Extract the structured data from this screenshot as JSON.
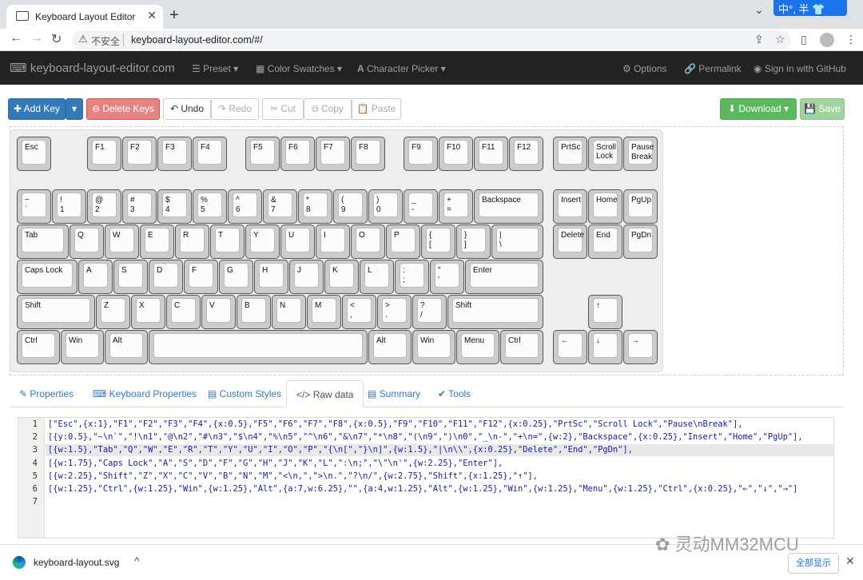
{
  "browser": {
    "tab_title": "Keyboard Layout Editor",
    "tab_close": "✕",
    "new_tab": "+",
    "tab_menu": "⌄",
    "ime": "中°, 半 👕",
    "back": "←",
    "forward": "→",
    "reload": "↻",
    "insecure_icon": "⚠",
    "insecure_label": "不安全",
    "url": "keyboard-layout-editor.com/#/",
    "share": "⇪",
    "star": "☆",
    "sidebar": "▯",
    "menu": "⋮"
  },
  "navbar": {
    "brand": "keyboard-layout-editor.com",
    "preset": "Preset ▾",
    "color_swatches": "Color Swatches ▾",
    "character_picker": "Character Picker ▾",
    "options": "Options",
    "permalink": "Permalink",
    "signin": "Sign in with GitHub"
  },
  "toolbar": {
    "add_key": "Add Key",
    "add_key_caret": "▾",
    "delete_keys": "Delete Keys",
    "undo": "Undo",
    "redo": "Redo",
    "cut": "Cut",
    "copy": "Copy",
    "paste": "Paste",
    "download": "Download ▾",
    "save": "Save"
  },
  "keys": [
    [
      "Esc",
      ""
    ],
    [
      "F1",
      ""
    ],
    [
      "F2",
      ""
    ],
    [
      "F3",
      ""
    ],
    [
      "F4",
      ""
    ],
    [
      "F5",
      ""
    ],
    [
      "F6",
      ""
    ],
    [
      "F7",
      ""
    ],
    [
      "F8",
      ""
    ],
    [
      "F9",
      ""
    ],
    [
      "F10",
      ""
    ],
    [
      "F11",
      ""
    ],
    [
      "F12",
      ""
    ],
    [
      "PrtSc",
      ""
    ],
    [
      "Scroll\nLock",
      ""
    ],
    [
      "Pause",
      "Break"
    ],
    [
      "~",
      "`"
    ],
    [
      "!",
      "1"
    ],
    [
      "@",
      "2"
    ],
    [
      "#",
      "3"
    ],
    [
      "$",
      "4"
    ],
    [
      "%",
      "5"
    ],
    [
      "^",
      "6"
    ],
    [
      "&",
      "7"
    ],
    [
      "*",
      "8"
    ],
    [
      "(",
      "9"
    ],
    [
      ")",
      "0"
    ],
    [
      "_",
      "-"
    ],
    [
      "+",
      "="
    ],
    [
      "Backspace",
      ""
    ],
    [
      "Insert",
      ""
    ],
    [
      "Home",
      ""
    ],
    [
      "PgUp",
      ""
    ],
    [
      "Tab",
      ""
    ],
    [
      "Q",
      ""
    ],
    [
      "W",
      ""
    ],
    [
      "E",
      ""
    ],
    [
      "R",
      ""
    ],
    [
      "T",
      ""
    ],
    [
      "Y",
      ""
    ],
    [
      "U",
      ""
    ],
    [
      "I",
      ""
    ],
    [
      "O",
      ""
    ],
    [
      "P",
      ""
    ],
    [
      "{",
      "["
    ],
    [
      "}",
      "]"
    ],
    [
      "|",
      "\\"
    ],
    [
      "Delete",
      ""
    ],
    [
      "End",
      ""
    ],
    [
      "PgDn",
      ""
    ],
    [
      "Caps Lock",
      ""
    ],
    [
      "A",
      ""
    ],
    [
      "S",
      ""
    ],
    [
      "D",
      ""
    ],
    [
      "F",
      ""
    ],
    [
      "G",
      ""
    ],
    [
      "H",
      ""
    ],
    [
      "J",
      ""
    ],
    [
      "K",
      ""
    ],
    [
      "L",
      ""
    ],
    [
      ":",
      ";"
    ],
    [
      "\"",
      "'"
    ],
    [
      "Enter",
      ""
    ],
    [
      "Shift",
      ""
    ],
    [
      "Z",
      ""
    ],
    [
      "X",
      ""
    ],
    [
      "C",
      ""
    ],
    [
      "V",
      ""
    ],
    [
      "B",
      ""
    ],
    [
      "N",
      ""
    ],
    [
      "M",
      ""
    ],
    [
      "<",
      ","
    ],
    [
      ">",
      "."
    ],
    [
      "?",
      "/"
    ],
    [
      "Shift",
      ""
    ],
    [
      "↑",
      ""
    ],
    [
      "Ctrl",
      ""
    ],
    [
      "Win",
      ""
    ],
    [
      "Alt",
      ""
    ],
    [
      "",
      ""
    ],
    [
      "Alt",
      ""
    ],
    [
      "Win",
      ""
    ],
    [
      "Menu",
      ""
    ],
    [
      "Ctrl",
      ""
    ],
    [
      "←",
      ""
    ],
    [
      "↓",
      ""
    ],
    [
      "→",
      ""
    ]
  ],
  "tabs": {
    "properties": "Properties",
    "keyboard_properties": "Keyboard Properties",
    "custom_styles": "Custom Styles",
    "raw_data": "Raw data",
    "summary": "Summary",
    "tools": "Tools"
  },
  "raw_data": {
    "line_numbers": [
      "1",
      "2",
      "3",
      "4",
      "5",
      "6",
      "7"
    ],
    "lines": [
      "[\"Esc\",{x:1},\"F1\",\"F2\",\"F3\",\"F4\",{x:0.5},\"F5\",\"F6\",\"F7\",\"F8\",{x:0.5},\"F9\",\"F10\",\"F11\",\"F12\",{x:0.25},\"PrtSc\",\"Scroll Lock\",\"Pause\\nBreak\"],",
      "[{y:0.5},\"~\\n`\",\"!\\n1\",\"@\\n2\",\"#\\n3\",\"$\\n4\",\"%\\n5\",\"^\\n6\",\"&\\n7\",\"*\\n8\",\"(\\n9\",\")\\n0\",\"_\\n-\",\"+\\n=\",{w:2},\"Backspace\",{x:0.25},\"Insert\",\"Home\",\"PgUp\"],",
      "[{w:1.5},\"Tab\",\"Q\",\"W\",\"E\",\"R\",\"T\",\"Y\",\"U\",\"I\",\"O\",\"P\",\"{\\n[\",\"}\\n]\",{w:1.5},\"|\\n\\\\\",{x:0.25},\"Delete\",\"End\",\"PgDn\"],",
      "[{w:1.75},\"Caps Lock\",\"A\",\"S\",\"D\",\"F\",\"G\",\"H\",\"J\",\"K\",\"L\",\":\\n;\",\"\\\"\\n'\",{w:2.25},\"Enter\"],",
      "[{w:2.25},\"Shift\",\"Z\",\"X\",\"C\",\"V\",\"B\",\"N\",\"M\",\"<\\n,\",\">\\n.\",\"?\\n/\",{w:2.75},\"Shift\",{x:1.25},\"↑\"],",
      "[{w:1.25},\"Ctrl\",{w:1.25},\"Win\",{w:1.25},\"Alt\",{a:7,w:6.25},\"\",{a:4,w:1.25},\"Alt\",{w:1.25},\"Win\",{w:1.25},\"Menu\",{w:1.25},\"Ctrl\",{x:0.25},\"←\",\"↓\",\"→\"]",
      ""
    ]
  },
  "download_bar": {
    "file_name": "keyboard-layout.svg",
    "chevron": "^",
    "show_all": "全部显示",
    "close": "✕"
  },
  "watermark": "灵动MM32MCU"
}
